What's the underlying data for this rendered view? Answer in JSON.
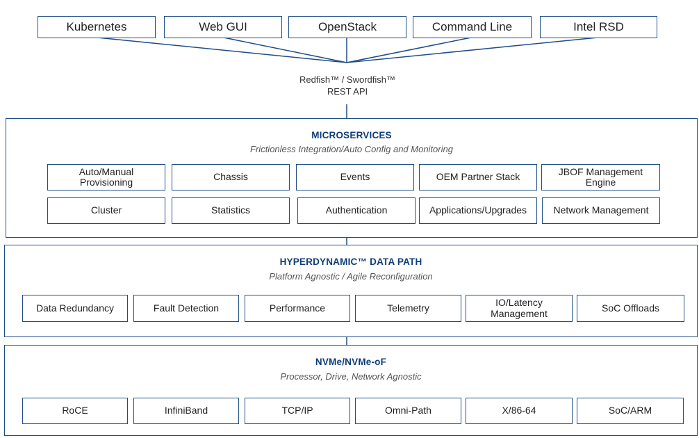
{
  "clients": [
    "Kubernetes",
    "Web GUI",
    "OpenStack",
    "Command Line",
    "Intel RSD"
  ],
  "api": {
    "line1": "Redfish™ / Swordfish™",
    "line2": "REST API"
  },
  "colors": {
    "border": "#1e4d86",
    "title": "#0f3d78",
    "connector": "#1e4d86"
  },
  "layers": {
    "microservices": {
      "title": "MICROSERVICES",
      "subtitle": "Frictionless Integration/Auto Config and Monitoring",
      "row1": [
        "Auto/Manual Provisioning",
        "Chassis",
        "Events",
        "OEM Partner Stack",
        "JBOF Management Engine"
      ],
      "row2": [
        "Cluster",
        "Statistics",
        "Authentication",
        "Applications/Upgrades",
        "Network Management"
      ]
    },
    "datapath": {
      "title": "HYPERDYNAMIC™ DATA PATH",
      "subtitle": "Platform Agnostic / Agile Reconfiguration",
      "items": [
        "Data Redundancy",
        "Fault Detection",
        "Performance",
        "Telemetry",
        "IO/Latency Management",
        "SoC Offloads"
      ]
    },
    "nvme": {
      "title": "NVMe/NVMe-oF",
      "subtitle": "Processor, Drive, Network Agnostic",
      "items": [
        "RoCE",
        "InfiniBand",
        "TCP/IP",
        "Omni-Path",
        "X/86-64",
        "SoC/ARM"
      ]
    }
  }
}
